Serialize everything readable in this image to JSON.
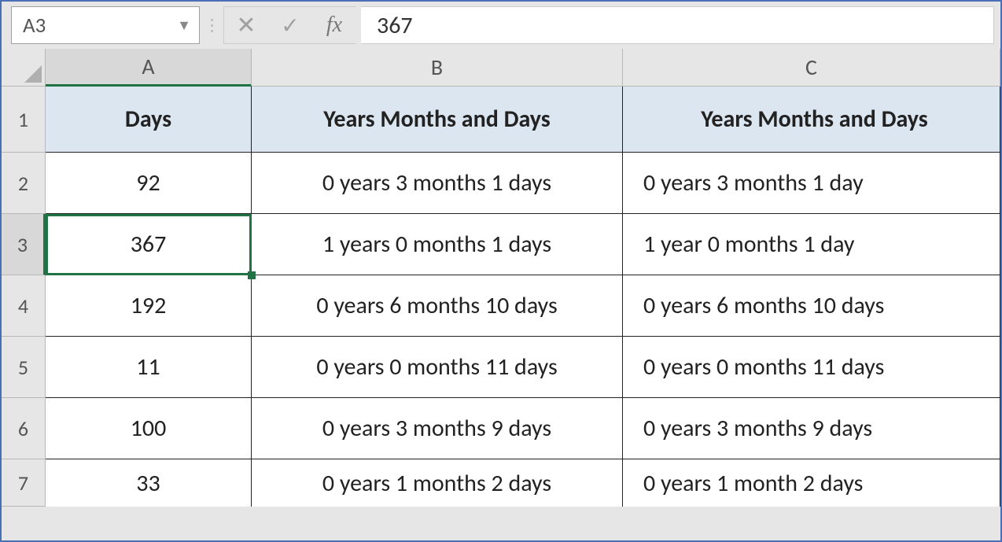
{
  "formula_bar": {
    "name_box": "A3",
    "fx_label": "fx",
    "value": "367"
  },
  "columns": [
    "A",
    "B",
    "C"
  ],
  "selected_col": "A",
  "selected_row": 3,
  "header_row": {
    "A": "Days",
    "B": "Years Months and Days",
    "C": "Years Months and Days"
  },
  "rows": [
    {
      "n": 2,
      "A": "92",
      "B": "0 years 3 months 1 days",
      "C": "0 years 3 months 1 day"
    },
    {
      "n": 3,
      "A": "367",
      "B": "1 years 0 months 1 days",
      "C": "1 year 0 months 1 day"
    },
    {
      "n": 4,
      "A": "192",
      "B": "0 years 6 months 10 days",
      "C": "0 years 6 months 10 days"
    },
    {
      "n": 5,
      "A": "11",
      "B": "0 years 0 months 11 days",
      "C": "0 years 0 months 11 days"
    },
    {
      "n": 6,
      "A": "100",
      "B": "0 years 3 months 9 days",
      "C": "0 years 3 months 9 days"
    },
    {
      "n": 7,
      "A": "33",
      "B": "0 years 1 months 2 days",
      "C": "0 years 1 month 2 days"
    }
  ],
  "chart_data": {
    "type": "table",
    "columns": [
      "Days",
      "Years Months and Days",
      "Years Months and Days"
    ],
    "rows": [
      [
        "92",
        "0 years 3 months 1 days",
        "0 years 3 months 1 day"
      ],
      [
        "367",
        "1 years 0 months 1 days",
        "1 year 0 months 1 day"
      ],
      [
        "192",
        "0 years 6 months 10 days",
        "0 years 6 months 10 days"
      ],
      [
        "11",
        "0 years 0 months 11 days",
        "0 years 0 months 11 days"
      ],
      [
        "100",
        "0 years 3 months 9 days",
        "0 years 3 months 9 days"
      ],
      [
        "33",
        "0 years 1 months 2 days",
        "0 years 1 month 2 days"
      ]
    ]
  }
}
